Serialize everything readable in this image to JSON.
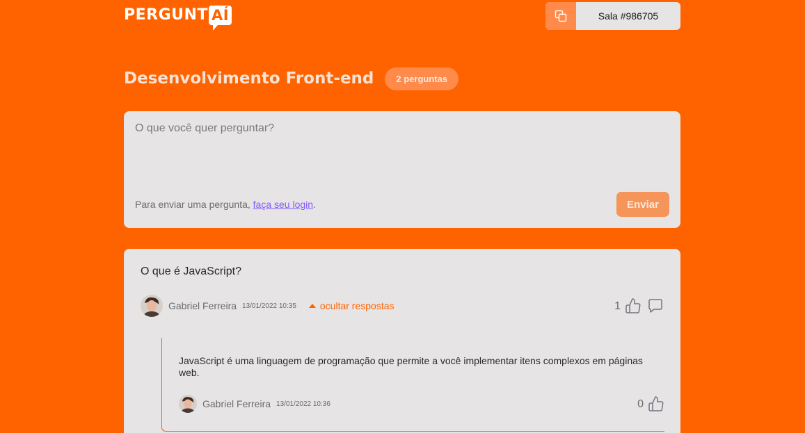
{
  "header": {
    "logo_main": "PERGUNT",
    "logo_bubble": "AÍ",
    "room_code_label": "Sala #986705",
    "copy_icon": "copy-icon"
  },
  "room": {
    "title": "Desenvolvimento Front-end",
    "question_count": "2 perguntas"
  },
  "form": {
    "placeholder": "O que você quer perguntar?",
    "login_prefix": "Para enviar uma pergunta, ",
    "login_link": "faça seu login",
    "login_suffix": ".",
    "send_label": "Enviar"
  },
  "questions": [
    {
      "content": "O que é JavaScript?",
      "author": "Gabriel Ferreira",
      "timestamp": "13/01/2022 10:35",
      "toggle_label": "ocultar respostas",
      "like_count": "1",
      "icons": [
        "thumbs-up-icon",
        "comment-icon",
        "caret-up-icon"
      ],
      "answers": [
        {
          "content": "JavaScript é uma linguagem de programação que permite a você implementar itens complexos em páginas web.",
          "author": "Gabriel Ferreira",
          "timestamp": "13/01/2022 10:36",
          "like_count": "0"
        }
      ]
    }
  ],
  "colors": {
    "background": "#ff6300",
    "card": "#e6e4e4",
    "accent": "#ff6300",
    "link": "#835afd",
    "button": "#f5955a"
  }
}
